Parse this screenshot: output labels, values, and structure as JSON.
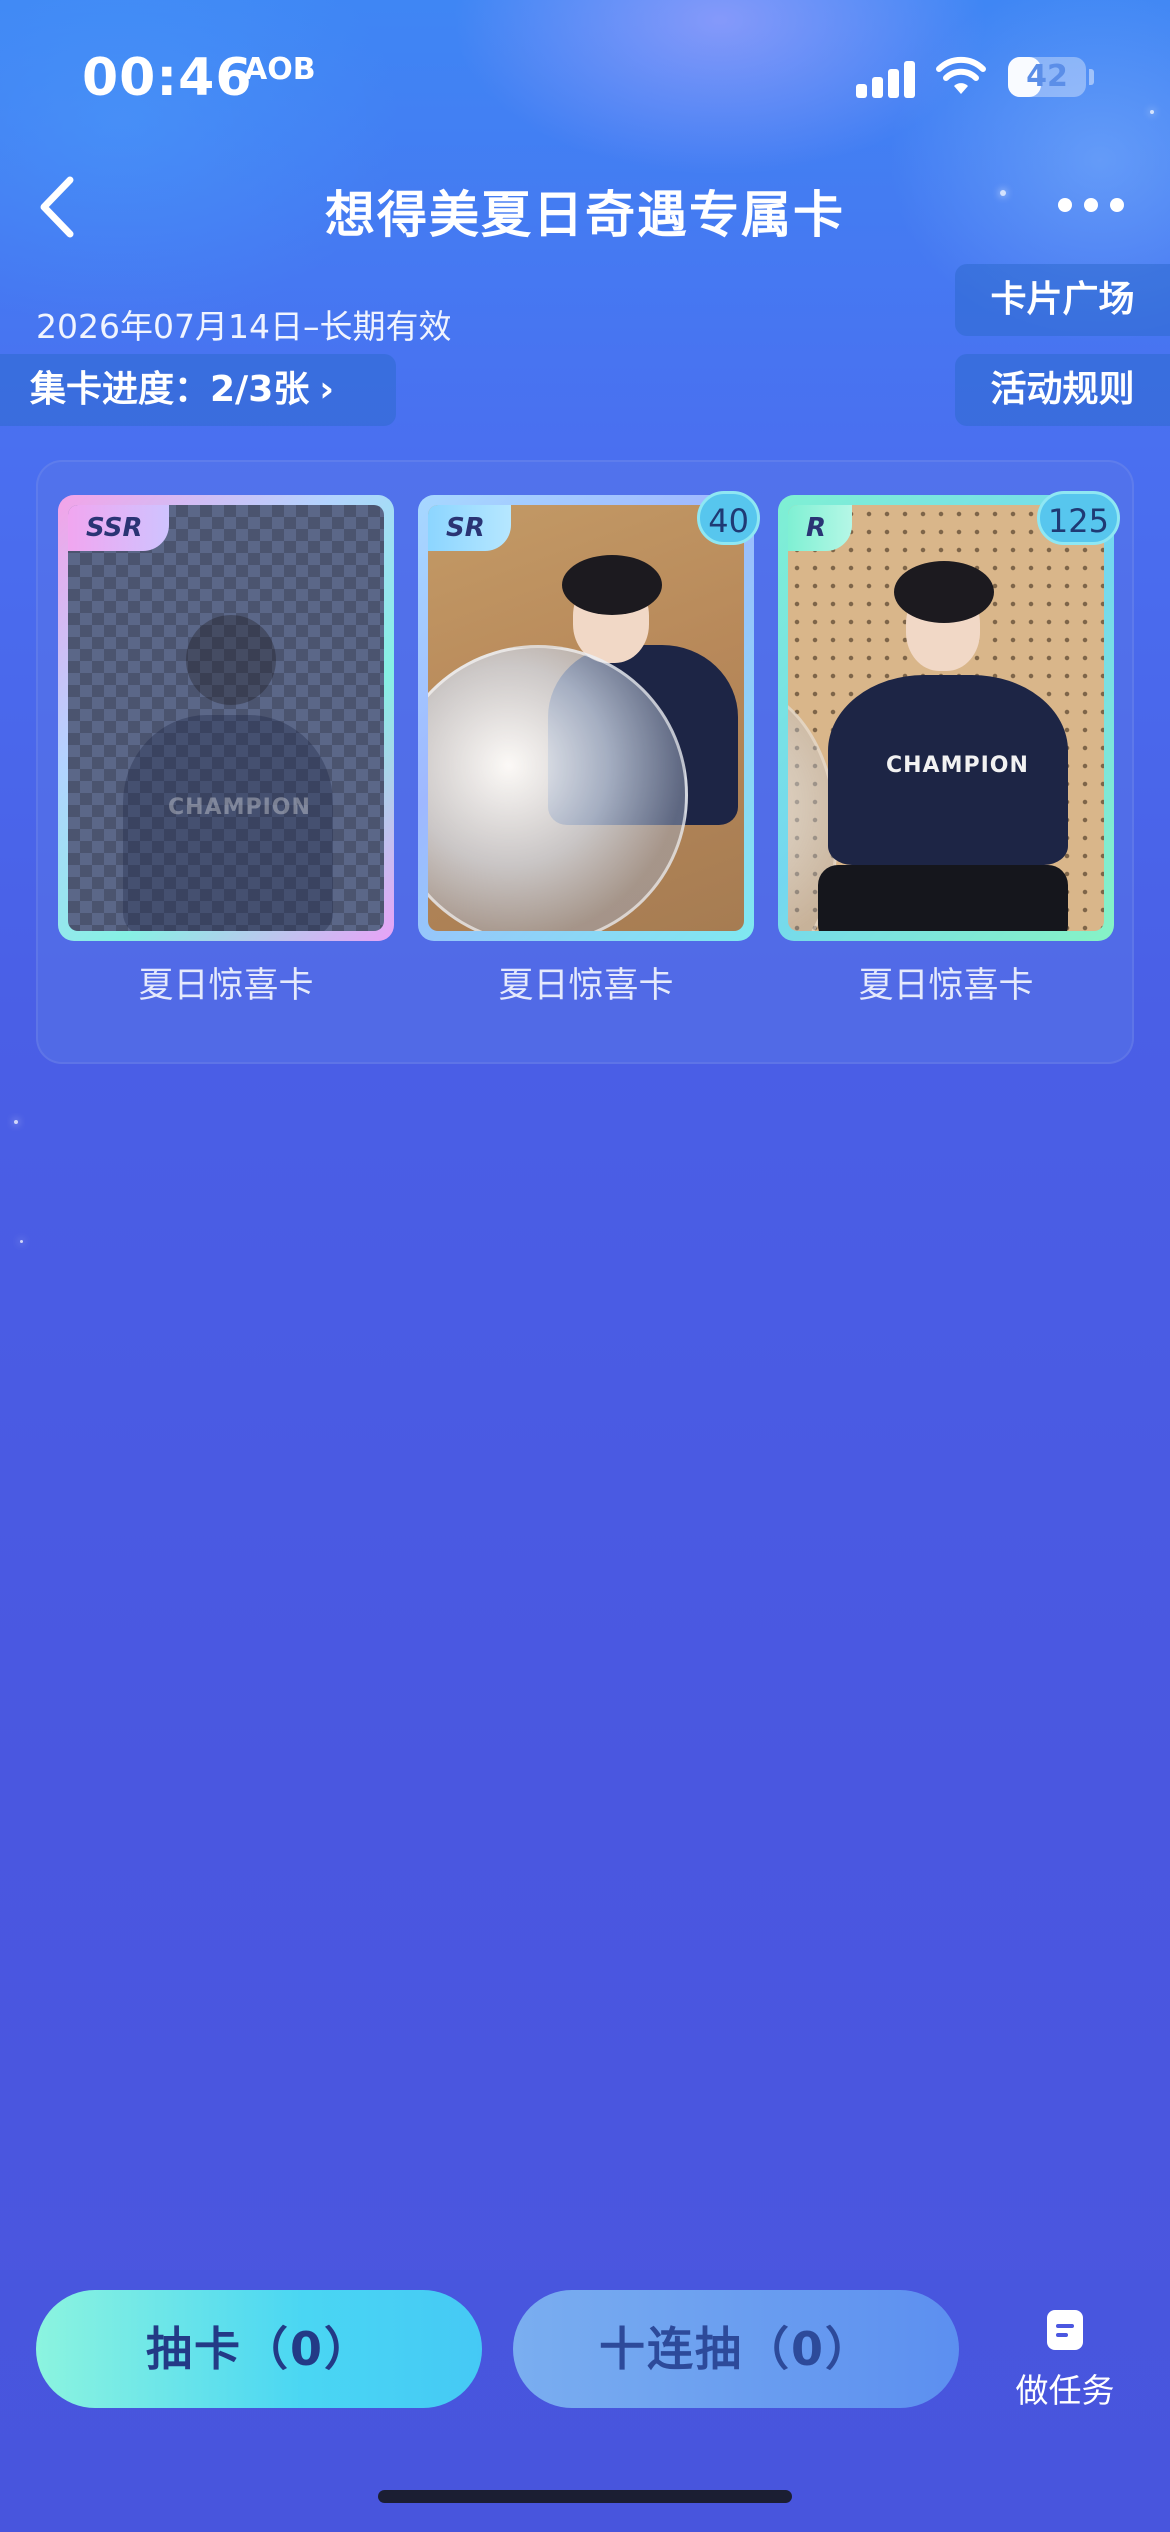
{
  "status_bar": {
    "time": "00:46",
    "app_indicator": "AOB",
    "battery": "42",
    "battery_level": 0.42
  },
  "header": {
    "title": "想得美夏日奇遇专属卡",
    "back_icon": "chevron-left-icon",
    "more_icon": "more-dots-icon"
  },
  "info": {
    "validity": "2026年07月14日–长期有效",
    "progress_label": "集卡进度：2/3张",
    "progress_chevron": "›"
  },
  "side_buttons": {
    "card_plaza": "卡片广场",
    "rules": "活动规则"
  },
  "cards": [
    {
      "rarity": "SSR",
      "name": "夏日惊喜卡",
      "count": "",
      "locked": true
    },
    {
      "rarity": "SR",
      "name": "夏日惊喜卡",
      "count": "40",
      "locked": false
    },
    {
      "rarity": "R",
      "name": "夏日惊喜卡",
      "count": "125",
      "locked": false
    }
  ],
  "card_shirt_text": "CHAMPION",
  "bottom": {
    "draw_label": "抽卡（0）",
    "ten_draw_label": "十连抽（0）",
    "task_label": "做任务",
    "task_icon": "document-icon"
  },
  "colors": {
    "accent_cyan": "#4ad6f3",
    "background_blue": "#4a57e0"
  }
}
